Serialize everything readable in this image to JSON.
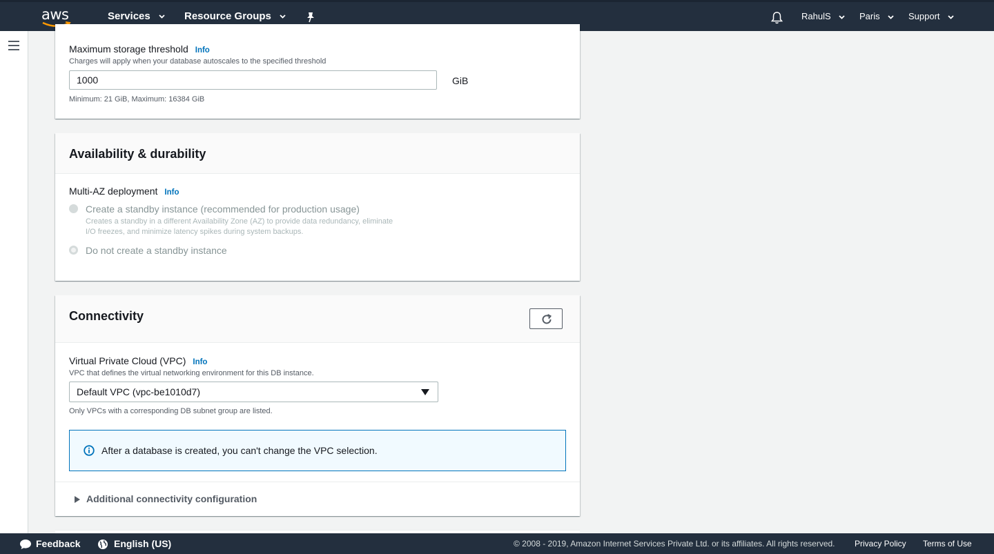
{
  "topnav": {
    "logo_text": "aws",
    "services": "Services",
    "resource_groups": "Resource Groups",
    "user": "RahulS",
    "region": "Paris",
    "support": "Support"
  },
  "storage": {
    "max_threshold_label": "Maximum storage threshold",
    "info": "Info",
    "description": "Charges will apply when your database autoscales to the specified threshold",
    "value": "1000",
    "unit": "GiB",
    "constraint": "Minimum: 21 GiB, Maximum: 16384 GiB"
  },
  "availability": {
    "title": "Availability & durability",
    "multi_az_label": "Multi-AZ deployment",
    "info": "Info",
    "option_standby_label": "Create a standby instance (recommended for production usage)",
    "option_standby_desc_1": "Creates a standby in a different Availability Zone (AZ) to provide data redundancy, eliminate",
    "option_standby_desc_2": "I/O freezes, and minimize latency spikes during system backups.",
    "option_no_standby_label": "Do not create a standby instance"
  },
  "connectivity": {
    "title": "Connectivity",
    "vpc_label": "Virtual Private Cloud (VPC)",
    "info": "Info",
    "vpc_description": "VPC that defines the virtual networking environment for this DB instance.",
    "vpc_selected": "Default VPC (vpc-be1010d7)",
    "vpc_note": "Only VPCs with a corresponding DB subnet group are listed.",
    "alert_text": "After a database is created, you can't change the VPC selection.",
    "additional_config": "Additional connectivity configuration"
  },
  "footer": {
    "feedback": "Feedback",
    "language": "English (US)",
    "copyright": "© 2008 - 2019, Amazon Internet Services Private Ltd. or its affiliates. All rights reserved.",
    "privacy": "Privacy Policy",
    "terms": "Terms of Use"
  },
  "colors": {
    "nav_bg": "#232f3e",
    "link_blue": "#0073bb",
    "aws_orange": "#ff9900",
    "page_bg": "#f2f3f3"
  }
}
